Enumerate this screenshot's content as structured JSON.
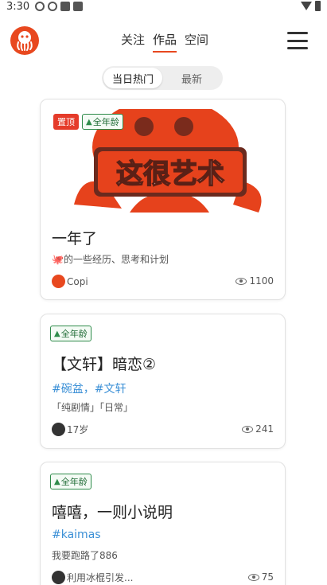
{
  "status_bar": {
    "time": "3:30"
  },
  "header": {
    "tabs": [
      {
        "label": "关注",
        "active": false
      },
      {
        "label": "作品",
        "active": true
      },
      {
        "label": "空间",
        "active": false
      }
    ]
  },
  "filter": {
    "options": [
      "当日热门",
      "最新"
    ],
    "selected": "当日热门"
  },
  "posts": [
    {
      "pinned_label": "置顶",
      "age_label": "全年龄",
      "cover_text": "这很艺术",
      "title": "一年了",
      "description": "🐙的一些经历、思考和计划",
      "author": "Copi",
      "views": "1100"
    },
    {
      "age_label": "全年龄",
      "title": "【文轩】暗恋②",
      "tags": "#碗盆，#文轩",
      "description": "「纯剧情」「日常」",
      "author": "17岁",
      "views": "241"
    },
    {
      "age_label": "全年龄",
      "title": "嘻嘻，一则小说明",
      "tags": "#kaimas",
      "description": "我要跑路了886",
      "author": "利用冰棍引发...",
      "views": "75"
    }
  ],
  "colors": {
    "accent": "#e8481f",
    "tag_blue": "#3a8fd6",
    "age_green": "#2e8b4a"
  }
}
